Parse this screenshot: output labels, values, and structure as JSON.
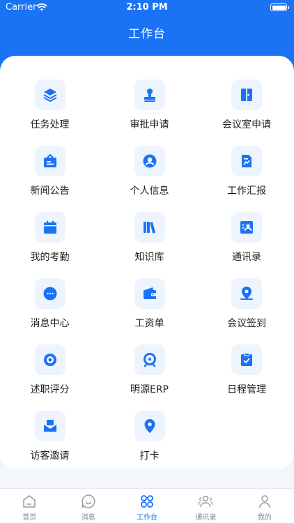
{
  "status_bar": {
    "carrier": "Carrier",
    "time": "2:10 PM"
  },
  "header": {
    "title": "工作台"
  },
  "colors": {
    "accent": "#1a73f5",
    "icon_bg": "#eef4fd"
  },
  "grid": {
    "items": [
      {
        "label": "任务处理",
        "icon": "layers-icon"
      },
      {
        "label": "审批申请",
        "icon": "stamp-icon"
      },
      {
        "label": "会议室申请",
        "icon": "door-icon"
      },
      {
        "label": "新闻公告",
        "icon": "bulletin-icon"
      },
      {
        "label": "个人信息",
        "icon": "user-circle-icon"
      },
      {
        "label": "工作汇报",
        "icon": "report-icon"
      },
      {
        "label": "我的考勤",
        "icon": "calendar-icon"
      },
      {
        "label": "知识库",
        "icon": "books-icon"
      },
      {
        "label": "通讯录",
        "icon": "contact-card-icon"
      },
      {
        "label": "消息中心",
        "icon": "chat-bubble-icon"
      },
      {
        "label": "工资单",
        "icon": "wallet-icon"
      },
      {
        "label": "会议签到",
        "icon": "location-check-icon"
      },
      {
        "label": "述职评分",
        "icon": "target-icon"
      },
      {
        "label": "明源ERP",
        "icon": "erp-icon"
      },
      {
        "label": "日程管理",
        "icon": "clipboard-check-icon"
      },
      {
        "label": "访客邀请",
        "icon": "mail-icon"
      },
      {
        "label": "打卡",
        "icon": "map-pin-icon"
      }
    ]
  },
  "tabbar": {
    "items": [
      {
        "label": "首页",
        "icon": "home-icon",
        "active": false
      },
      {
        "label": "消息",
        "icon": "smile-bubble-icon",
        "active": false
      },
      {
        "label": "工作台",
        "icon": "apps-icon",
        "active": true
      },
      {
        "label": "通讯录",
        "icon": "people-icon",
        "active": false
      },
      {
        "label": "我的",
        "icon": "person-icon",
        "active": false
      }
    ]
  }
}
